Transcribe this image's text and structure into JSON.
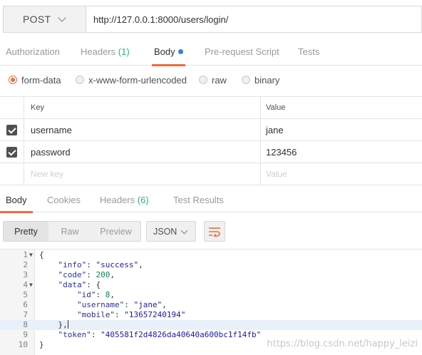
{
  "request": {
    "method": "POST",
    "url": "http://127.0.0.1:8000/users/login/"
  },
  "request_tabs": {
    "authorization": "Authorization",
    "headers_label": "Headers",
    "headers_count": "(1)",
    "body": "Body",
    "prerequest": "Pre-request Script",
    "tests": "Tests"
  },
  "body_types": {
    "form_data": "form-data",
    "urlencoded": "x-www-form-urlencoded",
    "raw": "raw",
    "binary": "binary",
    "selected": "form-data"
  },
  "params": {
    "key_header": "Key",
    "value_header": "Value",
    "rows": [
      {
        "key": "username",
        "value": "jane",
        "checked": true
      },
      {
        "key": "password",
        "value": "123456",
        "checked": true
      }
    ],
    "new_key_placeholder": "New key",
    "new_value_placeholder": "Value"
  },
  "response_tabs": {
    "body": "Body",
    "cookies": "Cookies",
    "headers_label": "Headers",
    "headers_count": "(6)",
    "test_results": "Test Results"
  },
  "response_view": {
    "pretty": "Pretty",
    "raw": "Raw",
    "preview": "Preview",
    "format": "JSON",
    "wrap_icon": "wrap-lines-icon"
  },
  "code": {
    "lines": [
      {
        "n": "1",
        "fold": true,
        "parts": [
          [
            "p",
            "{"
          ]
        ]
      },
      {
        "n": "2",
        "parts": [
          [
            "p",
            "    "
          ],
          [
            "k",
            "\"info\""
          ],
          [
            "p",
            ": "
          ],
          [
            "s",
            "\"success\""
          ],
          [
            "p",
            ","
          ]
        ]
      },
      {
        "n": "3",
        "parts": [
          [
            "p",
            "    "
          ],
          [
            "k",
            "\"code\""
          ],
          [
            "p",
            ": "
          ],
          [
            "n",
            "200"
          ],
          [
            "p",
            ","
          ]
        ]
      },
      {
        "n": "4",
        "fold": true,
        "parts": [
          [
            "p",
            "    "
          ],
          [
            "k",
            "\"data\""
          ],
          [
            "p",
            ": {"
          ]
        ]
      },
      {
        "n": "5",
        "parts": [
          [
            "p",
            "        "
          ],
          [
            "k",
            "\"id\""
          ],
          [
            "p",
            ": "
          ],
          [
            "n",
            "8"
          ],
          [
            "p",
            ","
          ]
        ]
      },
      {
        "n": "6",
        "parts": [
          [
            "p",
            "        "
          ],
          [
            "k",
            "\"username\""
          ],
          [
            "p",
            ": "
          ],
          [
            "s",
            "\"jane\""
          ],
          [
            "p",
            ","
          ]
        ]
      },
      {
        "n": "7",
        "parts": [
          [
            "p",
            "        "
          ],
          [
            "k",
            "\"mobile\""
          ],
          [
            "p",
            ": "
          ],
          [
            "s",
            "\"13657240194\""
          ]
        ]
      },
      {
        "n": "8",
        "highlight": true,
        "parts": [
          [
            "p",
            "    },"
          ]
        ]
      },
      {
        "n": "9",
        "parts": [
          [
            "p",
            "    "
          ],
          [
            "k",
            "\"token\""
          ],
          [
            "p",
            ": "
          ],
          [
            "s",
            "\"405581f2d4826da40640a600bc1f14fb\""
          ]
        ]
      },
      {
        "n": "10",
        "parts": [
          [
            "p",
            "}"
          ]
        ]
      }
    ]
  },
  "watermark": "https://blog.csdn.net/happy_leizi",
  "colors": {
    "accent": "#f26b3a",
    "count_green": "#26b47f",
    "dot_blue": "#2f84d6"
  }
}
